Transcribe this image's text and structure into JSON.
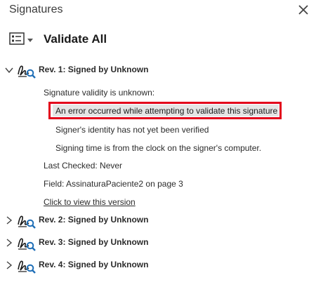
{
  "panel": {
    "title": "Signatures",
    "close_icon": "close-icon",
    "options_icon": "list-options-icon",
    "validate_all": "Validate All"
  },
  "revisions": [
    {
      "label": "Rev. 1: Signed by Unknown",
      "expanded": true,
      "details": {
        "validity": "Signature validity is unknown:",
        "error": "An error occurred while attempting to validate this signature",
        "identity": "Signer's identity has not yet been verified",
        "signing_time": "Signing time is from the clock on the signer's computer.",
        "last_checked": "Last Checked: Never",
        "field": "Field: AssinaturaPaciente2 on page 3",
        "view_link": "Click to view this version"
      }
    },
    {
      "label": "Rev. 2: Signed by Unknown",
      "expanded": false
    },
    {
      "label": "Rev. 3: Signed by Unknown",
      "expanded": false
    },
    {
      "label": "Rev. 4: Signed by Unknown",
      "expanded": false
    }
  ],
  "colors": {
    "error_border": "#e3001b",
    "error_highlight": "#e5e5e5",
    "icon_blue": "#1f6fb7"
  }
}
